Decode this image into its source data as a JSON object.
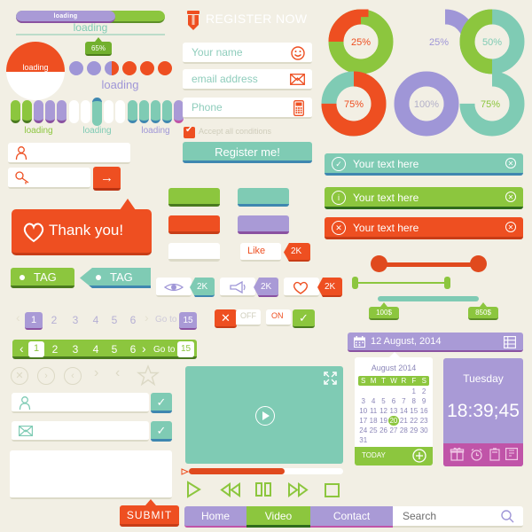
{
  "palette": {
    "background": "#f2efe4",
    "orange": "#ee4f21",
    "green": "#8cc63e",
    "teal": "#7fcbb4",
    "purple": "#9f96d7",
    "pink": "#c054a8",
    "white": "#ffffff"
  },
  "loaders": {
    "bar_label": "loading",
    "bar_percent": 66,
    "thin_bar_label": "loading",
    "circle_label": "loading",
    "tooltip_percent": "65%",
    "dots_label": "loading",
    "pill_groups": [
      {
        "label": "loading",
        "color": "#8cc63e"
      },
      {
        "label": "loading",
        "color": "#7fcbb4"
      },
      {
        "label": "loading",
        "color": "#9f96d7"
      }
    ]
  },
  "register": {
    "title": "REGISTER NOW",
    "pencil_icon": "pencil-icon",
    "fields": [
      {
        "placeholder": "Your name",
        "icon": "smiley-icon"
      },
      {
        "placeholder": "email address",
        "icon": "envelope-icon"
      },
      {
        "placeholder": "Phone",
        "icon": "mobile-phone-icon"
      }
    ],
    "checkbox_label": "Accept all conditions",
    "checkbox_checked": true,
    "submit_label": "Register me!"
  },
  "chart_data": {
    "type": "pie",
    "title": "Donut progress charts",
    "charts": [
      {
        "label": "25%",
        "value": 25,
        "fill": "#ee4f21",
        "rest": "#8cc63e",
        "style": "full-ring",
        "label_color": "#ee4f21"
      },
      {
        "label": "25%",
        "value": 25,
        "fill": "#9f96d7",
        "rest": "none",
        "style": "arc-only",
        "label_color": "#9f96d7"
      },
      {
        "label": "50%",
        "value": 50,
        "fill": "#8cc63e",
        "rest": "#7fcbb4",
        "style": "full-ring",
        "label_color": "#7fcbb4"
      },
      {
        "label": "75%",
        "value": 75,
        "fill": "#ee4f21",
        "rest": "#7fcbb4",
        "style": "full-ring",
        "label_color": "#ee4f21"
      },
      {
        "label": "100%",
        "value": 100,
        "fill": "#9f96d7",
        "rest": "none",
        "style": "full-ring",
        "label_color": "#b3b0c8"
      },
      {
        "label": "75%",
        "value": 75,
        "fill": "#7fcbb4",
        "rest": "none",
        "style": "arc-only",
        "label_color": "#8cc63e"
      }
    ]
  },
  "left_inputs": {
    "user_icon": "user-icon",
    "search_icon": "magnifier-key-icon",
    "go_arrow": "arrow-right-icon"
  },
  "thank_you": {
    "label": "Thank you!",
    "icon": "heart-icon"
  },
  "tags": [
    {
      "label": "TAG",
      "color": "#8cc63e"
    },
    {
      "label": "TAG",
      "color": "#7fcbb4"
    }
  ],
  "color_blocks": [
    {
      "color": "#8cc63e"
    },
    {
      "color": "#7fcbb4"
    },
    {
      "color": "#ee4f21"
    },
    {
      "color": "#a99ad6"
    },
    {
      "color": "#ffffff"
    }
  ],
  "like": {
    "label": "Like",
    "count": "2K"
  },
  "counters": [
    {
      "icon": "eye-icon",
      "count": "2K",
      "color": "#7fcbb4",
      "icon_color": "#9f96d7"
    },
    {
      "icon": "megaphone-icon",
      "count": "2K",
      "color": "#9f96d7",
      "icon_color": "#9f96d7"
    },
    {
      "icon": "heart-icon",
      "count": "2K",
      "color": "#ee4f21",
      "icon_color": "#ee4f21"
    }
  ],
  "pagination": {
    "pages": [
      "1",
      "2",
      "3",
      "4",
      "5",
      "6"
    ],
    "active": "1",
    "goto_label": "Go to",
    "goto_value": "15",
    "prev_icon": "chevron-left-icon",
    "next_icon": "chevron-right-icon"
  },
  "toggles": [
    {
      "state": "OFF",
      "icon": "cross-icon",
      "color": "#ee4f21"
    },
    {
      "state": "ON",
      "icon": "check-icon",
      "color": "#8cc63e"
    }
  ],
  "notifications": [
    {
      "text": "Your text here",
      "icon": "check-circle-icon",
      "color": "#7fcbb4",
      "underline": "#3f87b0"
    },
    {
      "text": "Your text here",
      "icon": "info-circle-icon",
      "color": "#8cc63e",
      "underline": "#2f6b1c"
    },
    {
      "text": "Your text here",
      "icon": "cross-circle-icon",
      "color": "#ee4f21",
      "underline": "#c83d17"
    }
  ],
  "sliders": [
    {
      "color": "#e04a1e",
      "style": "round-knobs",
      "min_label": "",
      "max_label": ""
    },
    {
      "color": "#8cc63e",
      "style": "pill-knobs",
      "min_label": "",
      "max_label": ""
    },
    {
      "color": "#7fcbb4",
      "style": "range-tags",
      "min_label": "100$",
      "max_label": "850$"
    }
  ],
  "icon_row": [
    "cross-circle-icon",
    "chevron-right-circle-icon",
    "chevron-left-circle-icon",
    "chevron-right-icon",
    "chevron-left-icon",
    "star-icon"
  ],
  "contact_form": {
    "name_icon": "user-icon",
    "email_icon": "envelope-icon",
    "check_icon": "check-circle-icon",
    "submit_label": "SUBMIT"
  },
  "date_bar": {
    "text": "12 August,  2014",
    "calendar_icon": "calendar-icon",
    "grid_icon": "grid-icon"
  },
  "video": {
    "play_icon": "play-circle-icon",
    "fullscreen_icon": "fullscreen-icon",
    "progress_percent": 62,
    "controls": [
      "play-icon",
      "rewind-icon",
      "pause-icon",
      "forward-icon",
      "stop-icon"
    ]
  },
  "calendar": {
    "month": "August 2014",
    "weekdays": [
      "S",
      "M",
      "T",
      "W",
      "R",
      "F",
      "S"
    ],
    "blanks": 5,
    "days": [
      1,
      2,
      3,
      4,
      5,
      6,
      7,
      8,
      9,
      10,
      11,
      12,
      13,
      14,
      15,
      16,
      17,
      18,
      19,
      20,
      21,
      22,
      23,
      24,
      25,
      26,
      27,
      28,
      29,
      30,
      31
    ],
    "selected": 20,
    "today_label": "TODAY",
    "add_icon": "plus-circle-icon"
  },
  "clock": {
    "weekday": "Tuesday",
    "time": "18:39;45",
    "icons": [
      "gift-icon",
      "alarm-clock-icon",
      "battery-icon",
      "note-icon"
    ]
  },
  "nav": {
    "items": [
      {
        "label": "Home",
        "active": false
      },
      {
        "label": "Video",
        "active": true
      },
      {
        "label": "Contact",
        "active": false
      }
    ],
    "search_placeholder": "Search",
    "search_icon": "search-icon"
  }
}
